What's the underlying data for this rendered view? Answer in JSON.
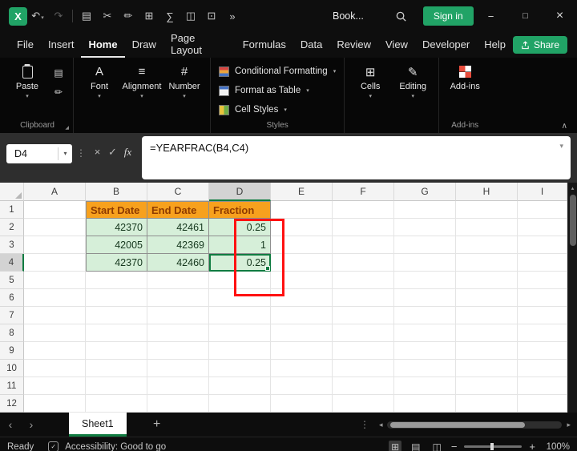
{
  "colors": {
    "accent_green": "#107C41",
    "button_green": "#21A366",
    "header_fill": "#F7A11E",
    "header_text": "#8F3B00",
    "cell_fill": "#D6EFD9",
    "cell_text": "#16381E",
    "annotation_red": "#FF1111",
    "titlebar_bg": "#0E0E0E",
    "ribbon_bg": "#070707",
    "formulabar_bg": "#2E2E2E"
  },
  "title_bar": {
    "doc_name": "Book...",
    "overflow": "»",
    "sign_in_label": "Sign in",
    "minimize": "−",
    "maximize": "□",
    "close": "×"
  },
  "menu_bar": {
    "tabs": [
      "File",
      "Insert",
      "Home",
      "Draw",
      "Page Layout",
      "Formulas",
      "Data",
      "Review",
      "View",
      "Developer",
      "Help"
    ],
    "active_tab": "Home",
    "share_label": "Share"
  },
  "ribbon": {
    "paste_label": "Paste",
    "font_label": "Font",
    "alignment_label": "Alignment",
    "number_label": "Number",
    "conditional_formatting_label": "Conditional Formatting",
    "format_as_table_label": "Format as Table",
    "cell_styles_label": "Cell Styles",
    "cells_label": "Cells",
    "editing_label": "Editing",
    "addins_label": "Add-ins",
    "group_clipboard_label": "Clipboard",
    "group_styles_label": "Styles",
    "group_addins_label": "Add-ins"
  },
  "formula_bar": {
    "name_box": "D4",
    "formula": "=YEARFRAC(B4,C4)"
  },
  "grid": {
    "columns": [
      "A",
      "B",
      "C",
      "D",
      "E",
      "F",
      "G",
      "H",
      "I"
    ],
    "row_count": 12,
    "active_cell": {
      "col": "D",
      "row": 4
    },
    "cells": [
      {
        "c": "B",
        "r": 1,
        "t": "Start Date",
        "style": "header"
      },
      {
        "c": "C",
        "r": 1,
        "t": "End Date",
        "style": "header"
      },
      {
        "c": "D",
        "r": 1,
        "t": "Fraction",
        "style": "header"
      },
      {
        "c": "B",
        "r": 2,
        "t": "42370",
        "style": "data"
      },
      {
        "c": "C",
        "r": 2,
        "t": "42461",
        "style": "data"
      },
      {
        "c": "D",
        "r": 2,
        "t": "0.25",
        "style": "data"
      },
      {
        "c": "B",
        "r": 3,
        "t": "42005",
        "style": "data"
      },
      {
        "c": "C",
        "r": 3,
        "t": "42369",
        "style": "data"
      },
      {
        "c": "D",
        "r": 3,
        "t": "1",
        "style": "data"
      },
      {
        "c": "B",
        "r": 4,
        "t": "42370",
        "style": "data"
      },
      {
        "c": "C",
        "r": 4,
        "t": "42460",
        "style": "data"
      },
      {
        "c": "D",
        "r": 4,
        "t": "0.25",
        "style": "data"
      }
    ]
  },
  "sheet_bar": {
    "tabs": [
      {
        "label": "Sheet1",
        "active": true
      }
    ],
    "add_sheet": "+"
  },
  "status_bar": {
    "mode": "Ready",
    "accessibility": "Accessibility: Good to go",
    "zoom": "100%"
  }
}
